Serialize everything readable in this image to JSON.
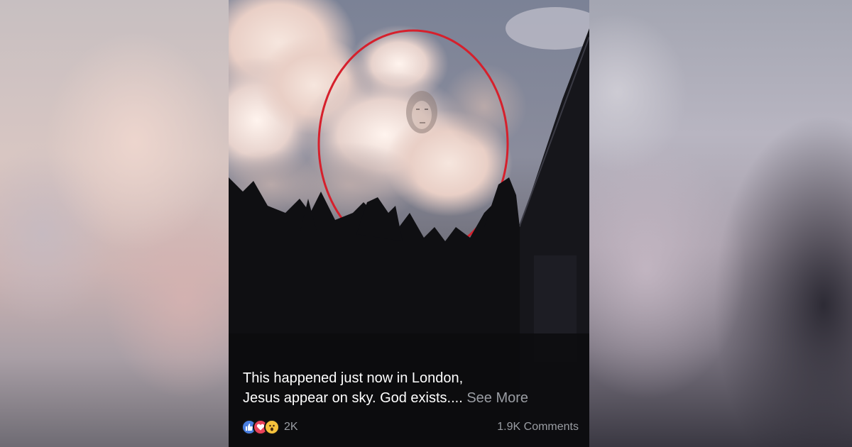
{
  "post": {
    "caption_line1": "This happened just now in London,",
    "caption_line2": "Jesus appear on sky. God exists....",
    "see_more": "See More",
    "reaction_count": "2K",
    "comments": "1.9K Comments",
    "reactions": [
      "like-icon",
      "love-icon",
      "wow-icon"
    ]
  },
  "colors": {
    "highlight_circle": "#d6202c",
    "like": "#4a7fe0",
    "love": "#e9435a",
    "wow": "#f5c23c",
    "muted_text": "#9a9da3"
  }
}
